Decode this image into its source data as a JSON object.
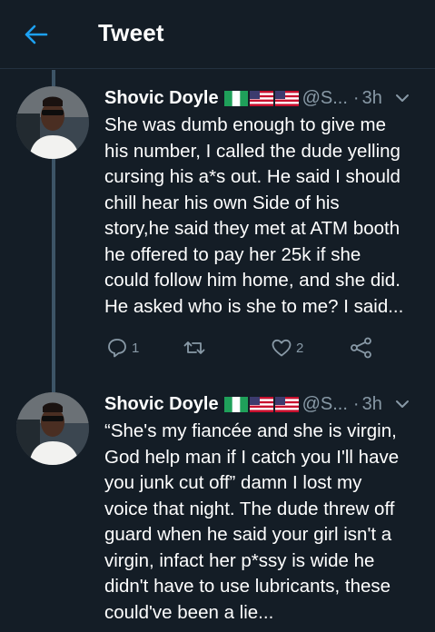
{
  "header": {
    "title": "Tweet"
  },
  "colors": {
    "background": "#141d26",
    "accent": "#1da1f2",
    "muted": "#8899a6",
    "thread_line": "#3d5466"
  },
  "tweets": [
    {
      "name": "Shovic Doyle",
      "flags": [
        "nigeria-flag",
        "us-flag",
        "us-flag"
      ],
      "handle": "@S...",
      "dot": "·",
      "time": "3h",
      "text": "She was dumb enough to give me\nhis number, I called the dude yelling\ncursing his a*s out. He said I should\nchill hear his own Side of his\nstory,he said they met at ATM booth\nhe offered to pay her 25k if she\ncould follow him home, and she did.\nHe asked who is she to me? I said...",
      "reply_count": "1",
      "retweet_count": "",
      "like_count": "2"
    },
    {
      "name": "Shovic Doyle",
      "flags": [
        "nigeria-flag",
        "us-flag",
        "us-flag"
      ],
      "handle": "@S...",
      "dot": "·",
      "time": "3h",
      "text": "“She's my fiancée and she is virgin,\nGod help man if I catch you I'll have\nyou junk cut off” damn I lost my\nvoice that night. The dude threw off\nguard when he said your girl isn't a\nvirgin, infact her p*ssy is wide he\ndidn't have to use lubricants, these\ncould've been a lie..."
    }
  ]
}
